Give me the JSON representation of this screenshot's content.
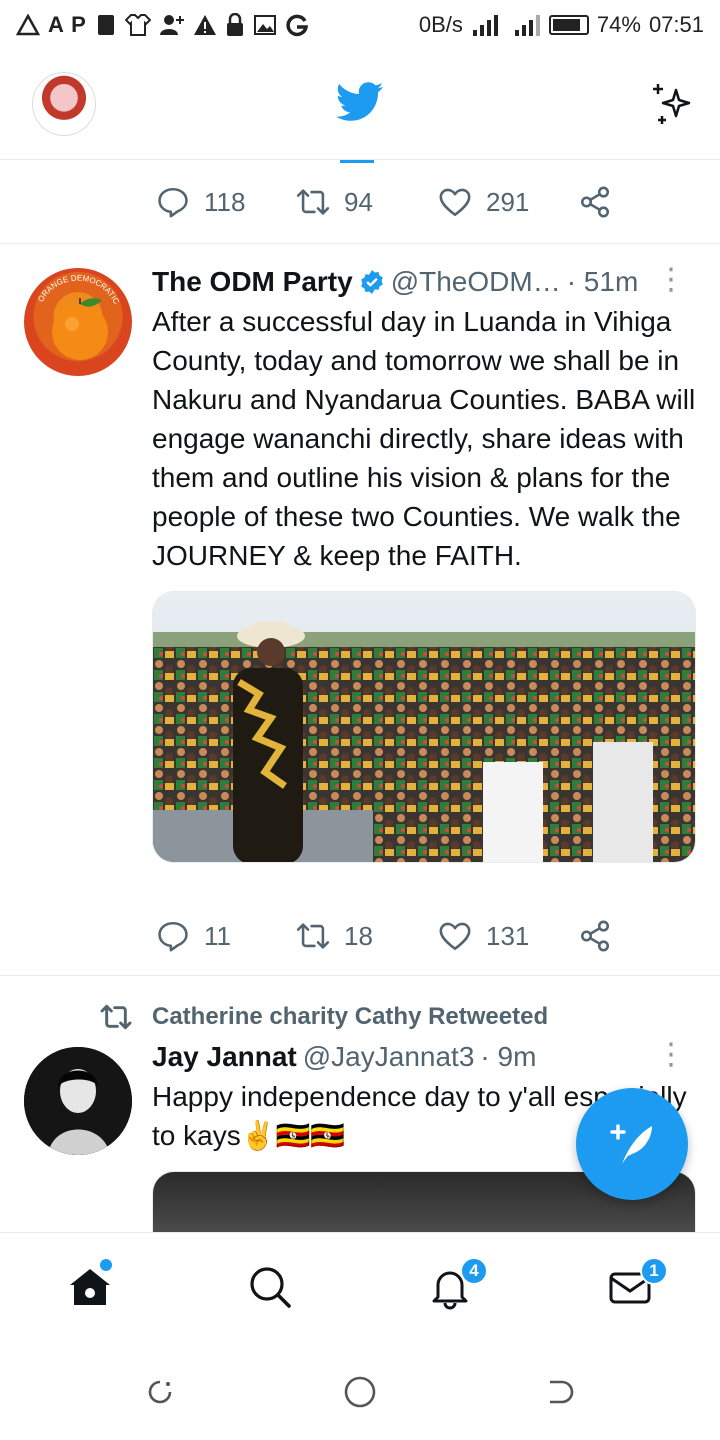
{
  "status_bar": {
    "left_icons": "A P",
    "speed": "0B/s",
    "battery": "74%",
    "time": "07:51"
  },
  "header": {
    "logo_icon": "twitter-bird-icon",
    "sparkle_icon": "sparkle-icon"
  },
  "prev_tweet": {
    "replies": "118",
    "retweets": "94",
    "likes": "291"
  },
  "tweet1": {
    "name": "The ODM Party",
    "handle": "@TheODM…",
    "time": "· 51m",
    "avatar_text": "ORANGE DEMOCRATIC MOVEMENT",
    "text": "After a successful day in Luanda in Vihiga County, today and tomorrow we shall be in Nakuru and Nyandarua Counties. BABA will engage wananchi directly, share ideas with them and outline his vision & plans for the people of these two Counties. We walk the JOURNEY & keep the FAITH.",
    "replies": "11",
    "retweets": "18",
    "likes": "131"
  },
  "tweet2": {
    "retweeted_by": "Catherine charity Cathy Retweeted",
    "name": "Jay Jannat",
    "handle": "@JayJannat3",
    "time": "· 9m",
    "text": "Happy independence day to y'all especially to kays✌️🇺🇬🇺🇬"
  },
  "nav": {
    "notifications_badge": "4",
    "messages_badge": "1"
  },
  "colors": {
    "accent": "#1d9bf0",
    "secondary_text": "#536471"
  }
}
